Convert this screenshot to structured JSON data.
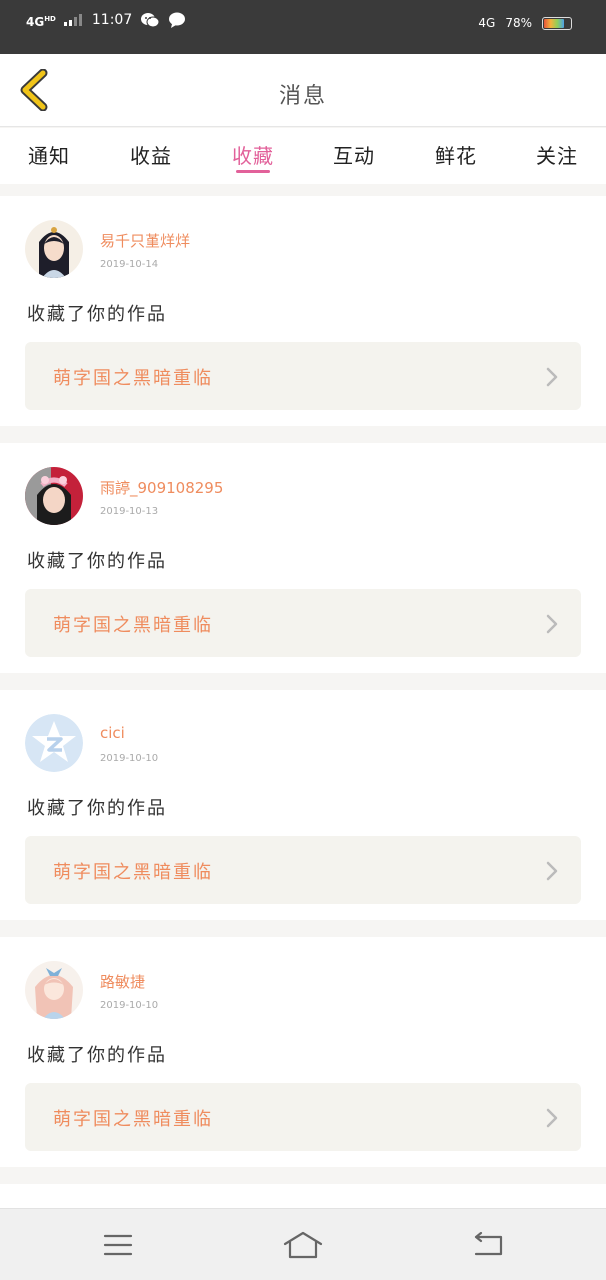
{
  "status_bar": {
    "network": "4G",
    "network_sup": "HD",
    "time": "11:07",
    "network_right": "4G",
    "battery": "78%",
    "battery_level": 0.78
  },
  "header": {
    "title": "消息",
    "back_icon": "chevron-left-icon"
  },
  "tabs": [
    {
      "label": "通知"
    },
    {
      "label": "收益"
    },
    {
      "label": "收藏"
    },
    {
      "label": "互动"
    },
    {
      "label": "鲜花"
    },
    {
      "label": "关注"
    }
  ],
  "active_tab": "收藏",
  "messages": [
    {
      "username": "易千只堇烊烊",
      "date": "2019-10-14",
      "action": "收藏了你的作品",
      "work_title": "萌字国之黑暗重临",
      "avatar_icon": "girl-portrait-avatar"
    },
    {
      "username": "雨諪_909108295",
      "date": "2019-10-13",
      "action": "收藏了你的作品",
      "work_title": "萌字国之黑暗重临",
      "avatar_icon": "girl-photo-avatar"
    },
    {
      "username": "cici",
      "date": "2019-10-10",
      "action": "收藏了你的作品",
      "work_title": "萌字国之黑暗重临",
      "avatar_icon": "qq-default-avatar"
    },
    {
      "username": "路敏捷",
      "date": "2019-10-10",
      "action": "收藏了你的作品",
      "work_title": "萌字国之黑暗重临",
      "avatar_icon": "anime-girl-avatar"
    }
  ],
  "colors": {
    "accent": "#e2619a",
    "username": "#ef8c5e",
    "card_link_bg": "#f4f3ee",
    "status_bar_bg": "#3a3a3a",
    "back_icon": "#f0c419"
  },
  "nav_bar": {
    "menu_icon": "menu-icon",
    "home_icon": "home-icon",
    "back_icon": "back-icon"
  }
}
